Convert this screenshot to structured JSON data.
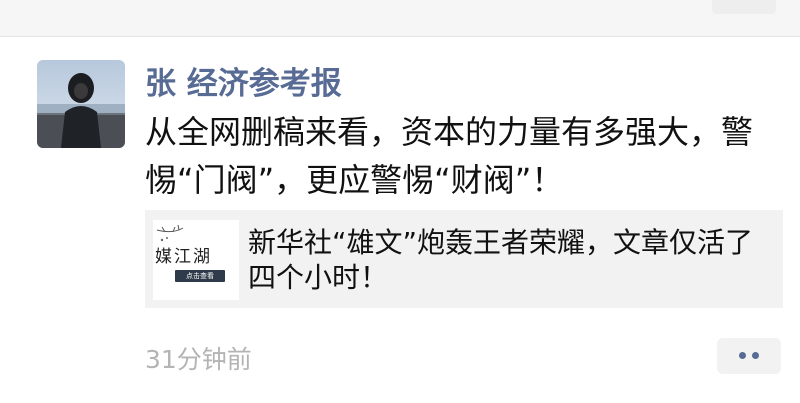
{
  "moment": {
    "author": "张 经济参考报",
    "text": "从全网删稿来看，资本的力量有多强大，警惕“门阀”，更应警惕“财阀”！",
    "share": {
      "thumbnail_title": "媒江湖",
      "thumbnail_button": "点击查看",
      "title": "新华社“雄文”炮轰王者荣耀，文章仅活了四个小时！"
    },
    "time": "31分钟前"
  },
  "icons": {
    "avatar": "person-avatar",
    "more": "more-dots-icon"
  },
  "colors": {
    "author_name": "#576b95",
    "share_background": "#f2f2f2",
    "timestamp": "#b4b4b4"
  }
}
